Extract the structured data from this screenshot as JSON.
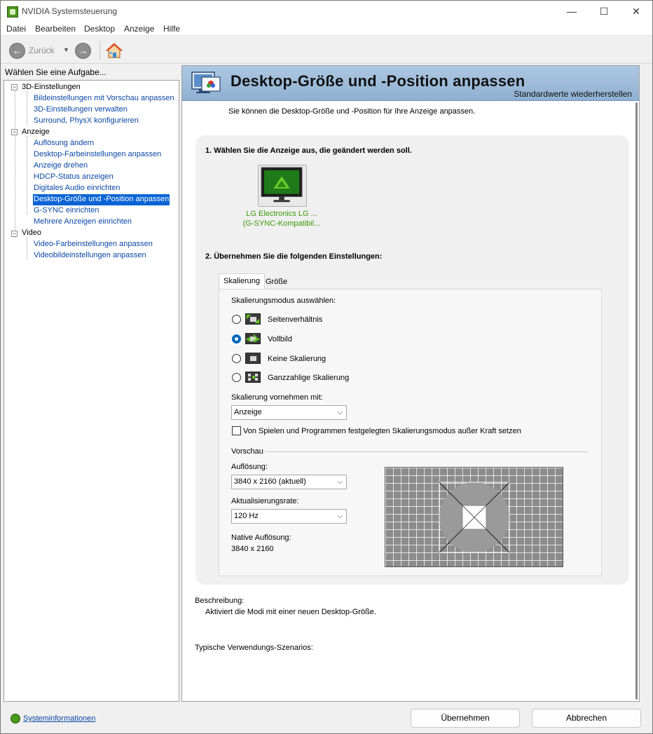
{
  "window": {
    "title": "NVIDIA Systemsteuerung",
    "minimize_glyph": "—",
    "maximize_glyph": "☐",
    "close_glyph": "✕"
  },
  "menu": [
    "Datei",
    "Bearbeiten",
    "Desktop",
    "Anzeige",
    "Hilfe"
  ],
  "toolbar": {
    "back_label": "Zurück",
    "back_glyph": "←",
    "forward_glyph": "→",
    "dropdown_glyph": "▼",
    "icons": [
      "back-arrow-icon",
      "forward-arrow-icon",
      "home-icon"
    ]
  },
  "sidebar": {
    "header": "Wählen Sie eine Aufgabe...",
    "toggle_glyph": "−",
    "groups": [
      {
        "label": "3D-Einstellungen",
        "items": [
          "Bildeinstellungen mit Vorschau anpassen",
          "3D-Einstellungen verwalten",
          "Surround, PhysX konfigurieren"
        ]
      },
      {
        "label": "Anzeige",
        "items": [
          "Auflösung ändern",
          "Desktop-Farbeinstellungen anpassen",
          "Anzeige drehen",
          "HDCP-Status anzeigen",
          "Digitales Audio einrichten",
          "Desktop-Größe und -Position anpassen",
          "G-SYNC einrichten",
          "Mehrere Anzeigen einrichten"
        ]
      },
      {
        "label": "Video",
        "items": [
          "Video-Farbeinstellungen anpassen",
          "Videobildeinstellungen anpassen"
        ]
      }
    ],
    "selected_item": "Desktop-Größe und -Position anpassen"
  },
  "page": {
    "title": "Desktop-Größe und -Position anpassen",
    "restore_defaults": "Standardwerte wiederherstellen",
    "intro": "Sie können die Desktop-Größe und -Position für Ihre Anzeige anpassen.",
    "step1": "1. Wählen Sie die Anzeige aus, die geändert werden soll.",
    "display": {
      "line1": "LG Electronics LG ...",
      "line2": "(G-SYNC-Kompatibil..."
    },
    "step2": "2. Übernehmen Sie die folgenden Einstellungen:",
    "tabs": [
      "Skalierung",
      "Größe"
    ],
    "active_tab": "Skalierung",
    "scaling_mode_label": "Skalierungsmodus auswählen:",
    "scaling_modes": [
      {
        "label": "Seitenverhältnis",
        "icon": "aspect-ratio-icon",
        "checked": false
      },
      {
        "label": "Vollbild",
        "icon": "fullscreen-icon",
        "checked": true
      },
      {
        "label": "Keine Skalierung",
        "icon": "no-scaling-icon",
        "checked": false
      },
      {
        "label": "Ganzzahlige Skalierung",
        "icon": "integer-scaling-icon",
        "checked": false
      }
    ],
    "perform_on_label": "Skalierung vornehmen mit:",
    "perform_on_value": "Anzeige",
    "override_checkbox": {
      "label": "Von Spielen und Programmen festgelegten Skalierungsmodus außer Kraft setzen",
      "checked": false
    },
    "preview_label": "Vorschau",
    "resolution_label": "Auflösung:",
    "resolution_value": "3840 x 2160 (aktuell)",
    "refresh_label": "Aktualisierungsrate:",
    "refresh_value": "120 Hz",
    "native_label": "Native Auflösung:",
    "native_value": "3840 x 2160",
    "description_label": "Beschreibung:",
    "description_text": "Aktiviert die Modi mit einer neuen Desktop-Größe.",
    "usage_label": "Typische Verwendungs-Szenarios:"
  },
  "footer": {
    "sysinfo": "Systeminformationen",
    "apply": "Übernehmen",
    "cancel": "Abbrechen"
  },
  "colors": {
    "link": "#0b47a5",
    "selection": "#0a64d6",
    "nvidia_green": "#76b900",
    "banner": "#9dbbd9"
  }
}
